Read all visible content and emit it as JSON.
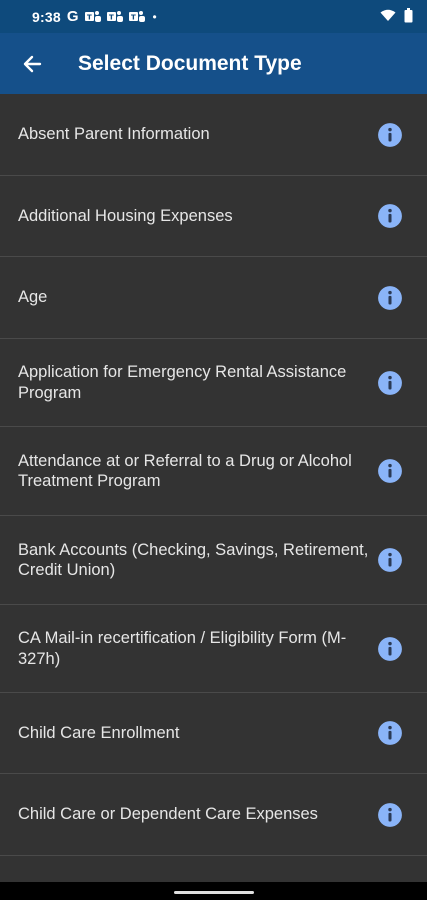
{
  "status_bar": {
    "time": "9:38",
    "g_label": "G",
    "notification_icons": [
      "teams-icon",
      "teams-icon",
      "teams-icon"
    ],
    "dot": "•"
  },
  "app_bar": {
    "title": "Select Document Type",
    "background": "#15508a"
  },
  "document_types": [
    {
      "label": "Absent Parent Information"
    },
    {
      "label": "Additional Housing Expenses"
    },
    {
      "label": "Age"
    },
    {
      "label": "Application for Emergency Rental Assistance Program"
    },
    {
      "label": "Attendance at or Referral to a Drug or Alcohol Treatment Program"
    },
    {
      "label": "Bank Accounts (Checking, Savings, Retirement, Credit Union)"
    },
    {
      "label": "CA Mail-in recertification / Eligibility Form (M-327h)"
    },
    {
      "label": "Child Care Enrollment"
    },
    {
      "label": "Child Care or Dependent Care Expenses"
    }
  ],
  "colors": {
    "info_icon": "#8ab4f8",
    "list_bg": "#333333",
    "divider": "#4a4a4a"
  }
}
